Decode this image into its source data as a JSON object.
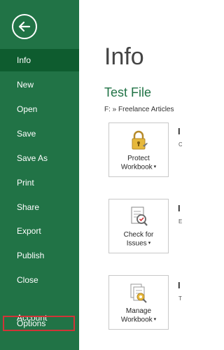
{
  "sidebar": {
    "items": [
      {
        "label": "Info"
      },
      {
        "label": "New"
      },
      {
        "label": "Open"
      },
      {
        "label": "Save"
      },
      {
        "label": "Save As"
      },
      {
        "label": "Print"
      },
      {
        "label": "Share"
      },
      {
        "label": "Export"
      },
      {
        "label": "Publish"
      },
      {
        "label": "Close"
      },
      {
        "label": "Account"
      },
      {
        "label": "Options"
      }
    ]
  },
  "main": {
    "title": "Info",
    "file_name": "Test File",
    "file_path": "F: » Freelance Articles",
    "cards": [
      {
        "line1": "Protect",
        "line2": "Workbook",
        "icon": "lock-icon"
      },
      {
        "line1": "Check for",
        "line2": "Issues",
        "icon": "inspect-document-icon"
      },
      {
        "line1": "Manage",
        "line2": "Workbook",
        "icon": "manage-workbook-icon"
      }
    ],
    "side_titles": [
      "I",
      "I",
      "I"
    ],
    "side_subs": [
      "C",
      "E",
      "T"
    ]
  },
  "colors": {
    "accent": "#217346",
    "highlight": "#d13438"
  }
}
